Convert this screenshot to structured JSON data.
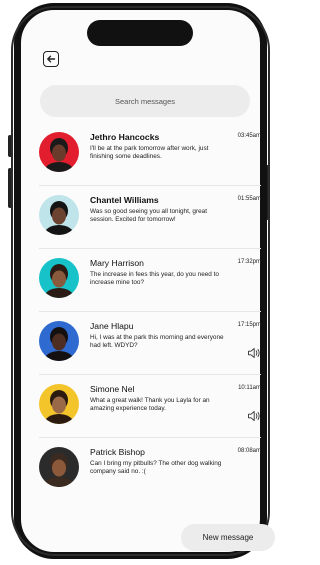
{
  "search": {
    "placeholder": "Search messages"
  },
  "conversations": [
    {
      "name": "Jethro Hancocks",
      "bold": true,
      "message": "I'll be at the park tomorrow after work, just finishing some deadlines.",
      "time": "03:45am",
      "avatar_bg": "#e21d2d",
      "skin": "#6a3a2a",
      "hair": "#1a1a1a",
      "audio": false
    },
    {
      "name": "Chantel Williams",
      "bold": true,
      "message": "Was so good seeing you all tonight, great session. Excited for tomorrow!",
      "time": "01:55am",
      "avatar_bg": "#bfe4ea",
      "skin": "#6b4330",
      "hair": "#141414",
      "audio": false
    },
    {
      "name": "Mary Harrison",
      "bold": false,
      "message": "The increase in fees this year, do you need to increase mine too?",
      "time": "17:32pm",
      "avatar_bg": "#17c2c9",
      "skin": "#8a5a3c",
      "hair": "#2a1c14",
      "audio": false
    },
    {
      "name": "Jane Hlapu",
      "bold": false,
      "message": "Hi, I was at the park this morning and everyone had left. WDYD?",
      "time": "17:15pm",
      "avatar_bg": "#2f6ad0",
      "skin": "#4e2e22",
      "hair": "#141010",
      "audio": true
    },
    {
      "name": "Simone Nel",
      "bold": false,
      "message": "What a great walk! Thank you Layla for an amazing experience today.",
      "time": "10:11am",
      "avatar_bg": "#f3c52a",
      "skin": "#9a6a48",
      "hair": "#2b1a10",
      "audio": true
    },
    {
      "name": "Patrick Bishop",
      "bold": false,
      "message": "Can I bring my pitbulls? The other dog walking company said no. :(",
      "time": "08:08am",
      "avatar_bg": "#2b2b2b",
      "skin": "#8c5a3a",
      "hair": "#3a2a20",
      "audio": false
    }
  ],
  "new_message_label": "New message",
  "icons": {
    "back": "back-arrow-icon",
    "audio": "speaker-icon"
  }
}
